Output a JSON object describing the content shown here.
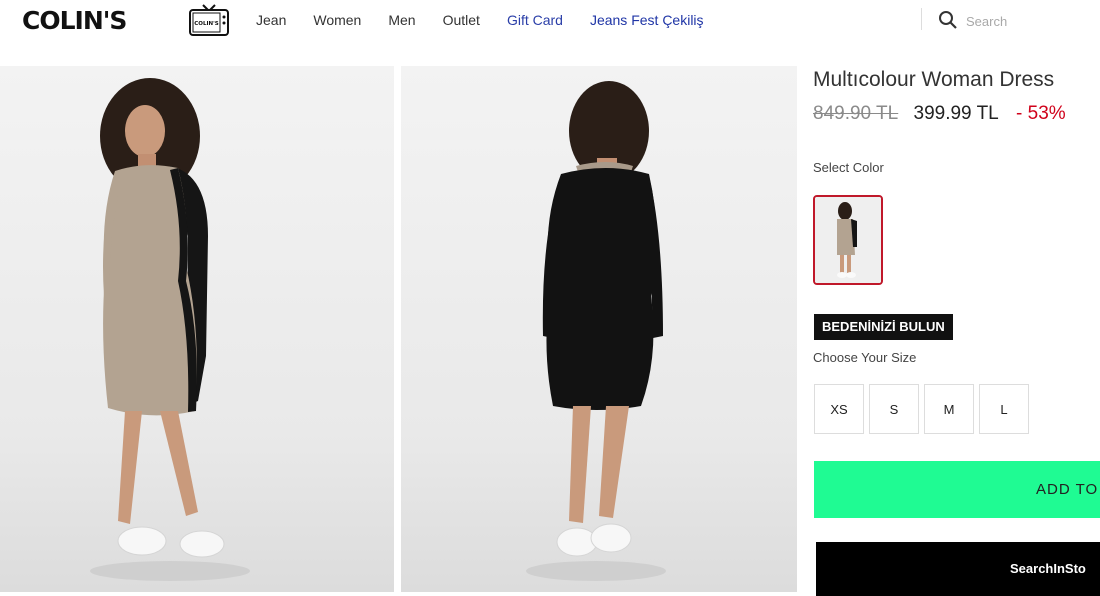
{
  "header": {
    "logo": "COLIN'S",
    "tv_logo_text": "COLIN'S",
    "nav": [
      "Jean",
      "Women",
      "Men",
      "Outlet",
      "Gift Card",
      "Jeans Fest Çekiliş"
    ],
    "search_placeholder": "Search"
  },
  "product": {
    "title": "Multıcolour Woman Dress",
    "old_price": "849.90 TL",
    "new_price": "399.99 TL",
    "discount": "- 53%",
    "select_color_label": "Select Color",
    "size_finder_label": "BEDENİNİZİ BULUN",
    "choose_size_label": "Choose Your Size",
    "sizes": [
      "XS",
      "S",
      "M",
      "L"
    ],
    "add_to_cart_label": "ADD TO",
    "search_in_store_label": "SearchInSto"
  },
  "colors": {
    "add_button": "#1ffb93",
    "discount": "#d0021b",
    "swatch_border": "#c0182a",
    "nav_link": "#2a3ea8"
  },
  "icons": {
    "tv": "tv-icon",
    "search": "search-icon"
  }
}
